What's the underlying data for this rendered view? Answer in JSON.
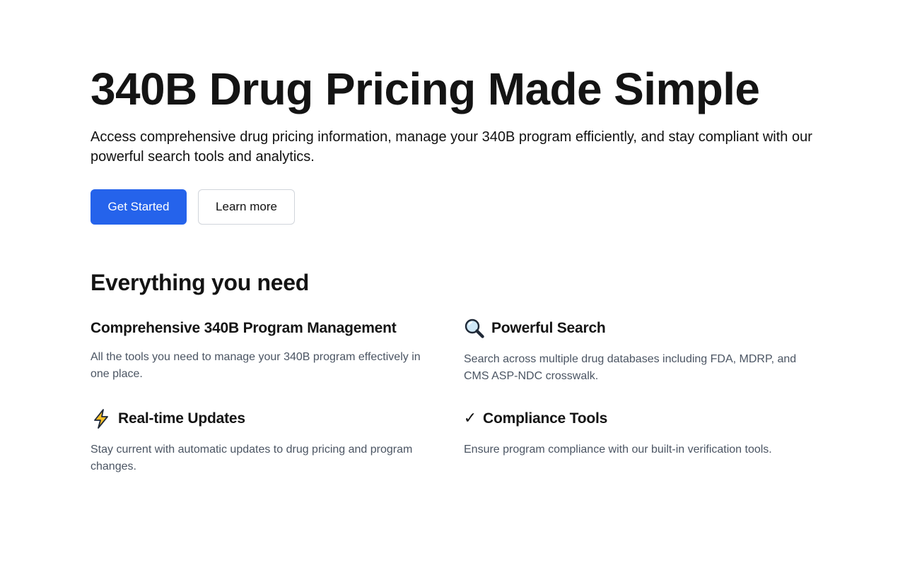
{
  "hero": {
    "title": "340B Drug Pricing Made Simple",
    "subtitle": "Access comprehensive drug pricing information, manage your 340B program efficiently, and stay compliant with our powerful search tools and analytics.",
    "primary_button": "Get Started",
    "secondary_button": "Learn more"
  },
  "features_section": {
    "title": "Everything you need",
    "items": [
      {
        "icon": "",
        "title": "Comprehensive 340B Program Management",
        "description": "All the tools you need to manage your 340B program effectively in one place."
      },
      {
        "icon": "magnifying-glass-icon",
        "title": "Powerful Search",
        "description": "Search across multiple drug databases including FDA, MDRP, and CMS ASP-NDC crosswalk."
      },
      {
        "icon": "lightning-bolt-icon",
        "title": "Real-time Updates",
        "description": "Stay current with automatic updates to drug pricing and program changes."
      },
      {
        "icon": "checkmark-icon",
        "title": "Compliance Tools",
        "description": "Ensure program compliance with our built-in verification tools."
      }
    ]
  },
  "colors": {
    "primary": "#2563eb",
    "text": "#141414",
    "muted_text": "#4b5563",
    "border": "#d1d5db",
    "bolt": "#fbbf24"
  }
}
